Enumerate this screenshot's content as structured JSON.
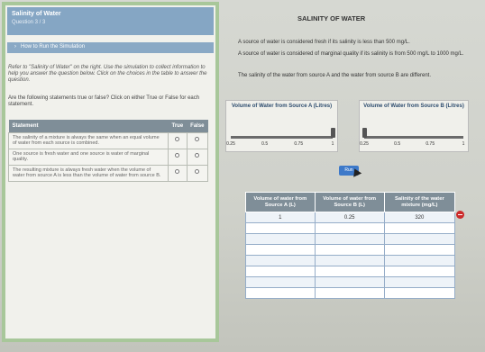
{
  "header": {
    "title": "Salinity of Water",
    "question_number": "Question 3 / 3"
  },
  "how_to": {
    "arrow": "›",
    "label": "How to Run the Simulation"
  },
  "instructions": "Refer to \"Salinity of Water\" on the right. Use the simulation to collect information to help you answer the question below. Click on the choices in the table to answer the question.",
  "question": "Are the following statements true or false? Click on either True or False for each statement.",
  "statement_table": {
    "headers": [
      "Statement",
      "True",
      "False"
    ],
    "rows": [
      "The salinity of a mixture is always the same when an equal volume of water from each source is combined.",
      "One source is fresh water and one source is water of marginal quality.",
      "The resulting mixture is always fresh water when the volume of water from source A is less than the volume of water from source B."
    ]
  },
  "sim": {
    "title": "SALINITY OF WATER",
    "para1": "A source of water is considered fresh if its salinity is less than 500 mg/L.",
    "para2": "A source of water is considered of marginal quality if its salinity is from 500 mg/L to 1000 mg/L.",
    "para3": "The salinity of the water from source A and the water from source B are different.",
    "slider_a": {
      "heading": "Volume of Water from Source A (Litres)",
      "ticks": [
        "0.25",
        "0.5",
        "0.75",
        "1"
      ],
      "value": 1
    },
    "slider_b": {
      "heading": "Volume of Water from Source B (Litres)",
      "ticks": [
        "0.25",
        "0.5",
        "0.75",
        "1"
      ],
      "value": 0.25
    },
    "submit_label": "Run"
  },
  "data_table": {
    "headers": [
      "Volume of water from Source A (L)",
      "Volume of water from Source B (L)",
      "Salinity of the water mixture (mg/L)"
    ],
    "rows": [
      [
        "1",
        "0.25",
        "320"
      ],
      [
        "",
        "",
        ""
      ],
      [
        "",
        "",
        ""
      ],
      [
        "",
        "",
        ""
      ],
      [
        "",
        "",
        ""
      ],
      [
        "",
        "",
        ""
      ],
      [
        "",
        "",
        ""
      ],
      [
        "",
        "",
        ""
      ]
    ]
  },
  "colors": {
    "accent": "#85a6c4",
    "table_header": "#7f8e98",
    "delete_button": "#cc2a2a"
  }
}
